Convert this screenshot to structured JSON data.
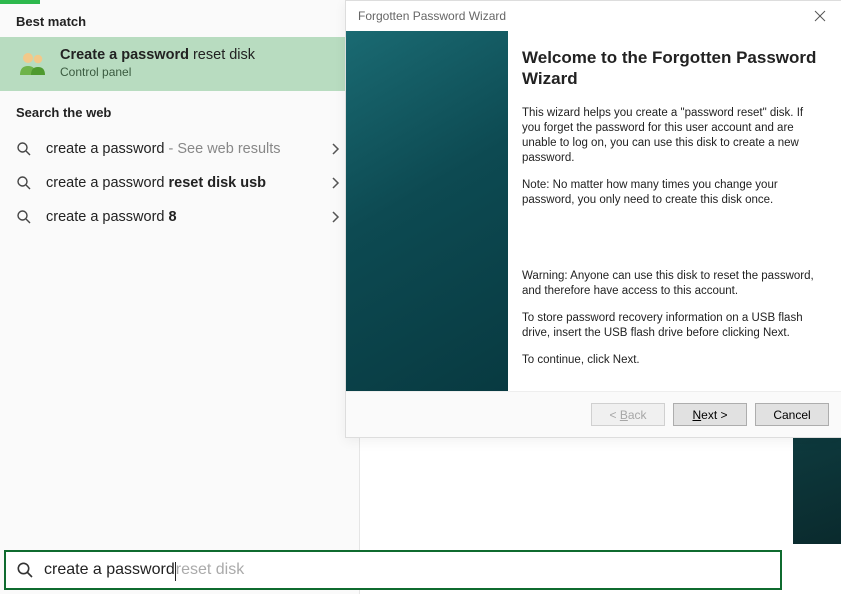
{
  "search_panel": {
    "best_match_header": "Best match",
    "best_match": {
      "title_bold": "Create a password",
      "title_rest": " reset disk",
      "subtitle": "Control panel"
    },
    "web_header": "Search the web",
    "web_items": [
      {
        "prefix": "create a password",
        "suffix_light": " - See web results",
        "suffix_bold": ""
      },
      {
        "prefix": "create a password ",
        "suffix_light": "",
        "suffix_bold": "reset disk usb"
      },
      {
        "prefix": "create a password ",
        "suffix_light": "",
        "suffix_bold": "8"
      }
    ]
  },
  "search_bar": {
    "typed": "create a password",
    "ghost": " reset disk"
  },
  "wizard": {
    "title": "Forgotten Password Wizard",
    "heading": "Welcome to the Forgotten Password Wizard",
    "para1": "This wizard helps you create a \"password reset\" disk. If you forget the password for this user account and are unable to log on, you can use this disk to create a new password.",
    "para2": "Note: No matter how many times you change your password, you only need to create this disk once.",
    "para3": "Warning: Anyone can use this disk to reset the password, and therefore have access to this account.",
    "para4": "To store password recovery information on a USB flash drive, insert the USB flash drive before clicking Next.",
    "para5": "To continue, click Next.",
    "buttons": {
      "back_prefix": "< ",
      "back_accel": "B",
      "back_rest": "ack",
      "next_accel": "N",
      "next_rest": "ext >",
      "cancel": "Cancel"
    }
  }
}
